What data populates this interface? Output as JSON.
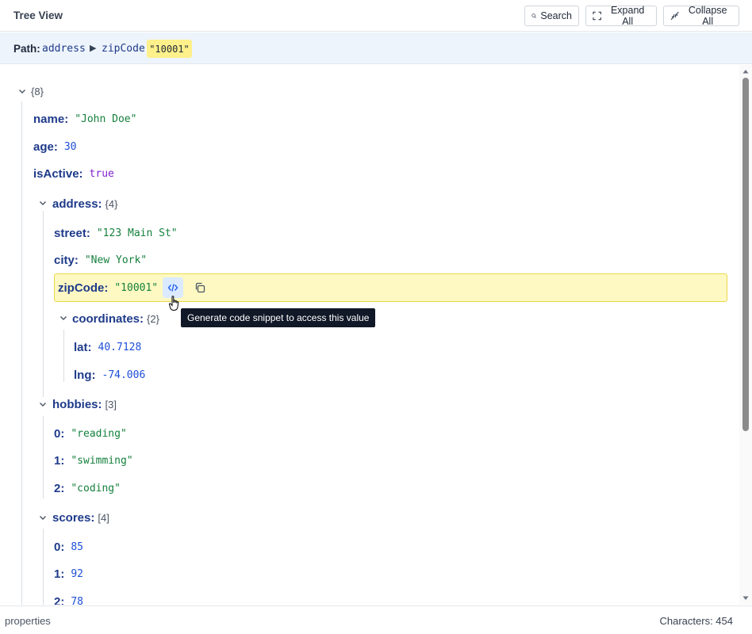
{
  "header": {
    "title": "Tree View",
    "search_label": "Search",
    "expand_label": "Expand All",
    "collapse_label": "Collapse All"
  },
  "path": {
    "label": "Path:",
    "segments": [
      "address",
      "zipCode"
    ],
    "separator": "▶",
    "value": "\"10001\""
  },
  "tree": {
    "root_count": "{8}",
    "name_key": "name",
    "name_value": "\"John Doe\"",
    "age_key": "age",
    "age_value": "30",
    "isActive_key": "isActive",
    "isActive_value": "true",
    "address_key": "address",
    "address_count": "{4}",
    "street_key": "street",
    "street_value": "\"123 Main St\"",
    "city_key": "city",
    "city_value": "\"New York\"",
    "zip_key": "zipCode",
    "zip_value": "\"10001\"",
    "coordinates_key": "coordinates",
    "coordinates_count": "{2}",
    "lat_key": "lat",
    "lat_value": "40.7128",
    "lng_key": "lng",
    "lng_value": "-74.006",
    "hobbies_key": "hobbies",
    "hobbies_count": "[3]",
    "hobbies": [
      {
        "index": "0",
        "value": "\"reading\""
      },
      {
        "index": "1",
        "value": "\"swimming\""
      },
      {
        "index": "2",
        "value": "\"coding\""
      }
    ],
    "scores_key": "scores",
    "scores_count": "[4]",
    "scores": [
      {
        "index": "0",
        "value": "85"
      },
      {
        "index": "1",
        "value": "92"
      },
      {
        "index": "2",
        "value": "78"
      }
    ],
    "colon": ":"
  },
  "tooltip": "Generate code snippet to access this value",
  "footer": {
    "left": "properties",
    "right": "Characters: 454"
  },
  "colors": {
    "key": "#1e3a8a",
    "string": "#15803d",
    "number": "#1d4ed8",
    "boolean": "#7e22ce",
    "highlight": "#fef9c3",
    "path_bg": "#eef4fc"
  },
  "icons": [
    "search-icon",
    "expand-icon",
    "collapse-icon",
    "chevron-down-icon",
    "code-icon",
    "copy-icon",
    "hand-cursor-icon"
  ]
}
